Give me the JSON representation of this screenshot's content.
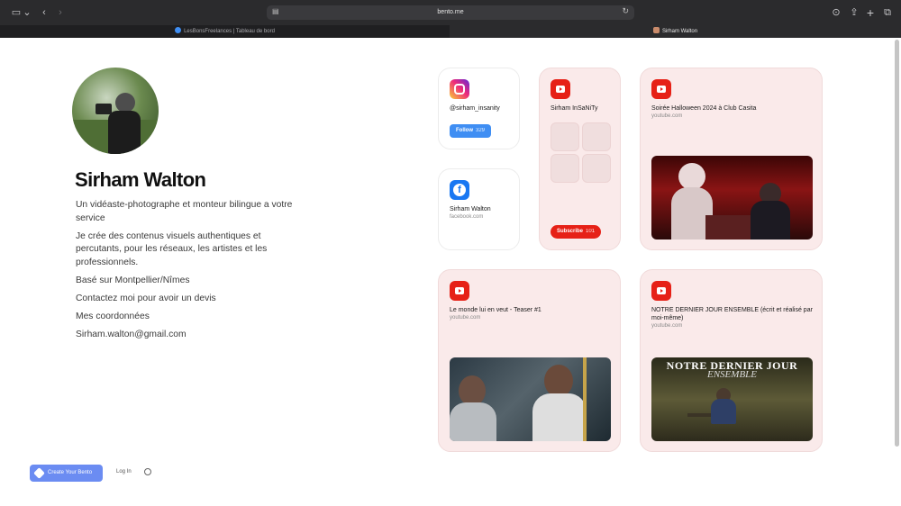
{
  "browser": {
    "url": "bento.me",
    "tabs": [
      {
        "label": "LesBonsFreelances | Tableau de bord",
        "active": false
      },
      {
        "label": "Sirham Walton",
        "active": true
      }
    ]
  },
  "profile": {
    "name": "Sirham Walton",
    "bio": [
      "Un vidéaste-photographe et monteur bilingue a votre service",
      "Je crée des contenus visuels authentiques et percutants, pour les réseaux, les artistes et les professionnels.",
      "Basé sur Montpellier/Nîmes",
      "Contactez moi pour avoir un devis",
      "Mes coordonnées",
      "Sirham.walton@gmail.com"
    ]
  },
  "footer": {
    "create_label": "Create Your Bento",
    "login_label": "Log In"
  },
  "cards": {
    "instagram": {
      "handle": "@sirham_insanity",
      "button": "Follow",
      "count": "329",
      "icon": "instagram-icon"
    },
    "facebook": {
      "title": "Sirham Walton",
      "domain": "facebook.com",
      "icon": "facebook-icon"
    },
    "youtube_channel": {
      "title": "Sirham InSaNiTy",
      "button": "Subscribe",
      "count": "101",
      "icon": "youtube-icon"
    },
    "halloween": {
      "title": "Soirée Halloween 2024 à Club Casita",
      "domain": "youtube.com",
      "icon": "youtube-icon"
    },
    "teaser": {
      "title": "Le monde lui en veut - Teaser #1",
      "domain": "youtube.com",
      "icon": "youtube-icon"
    },
    "dernier": {
      "title": "NOTRE DERNIER JOUR ENSEMBLE (écrit et réalisé par moi-même)",
      "domain": "youtube.com",
      "icon": "youtube-icon",
      "thumb_line1": "NOTRE DERNIER JOUR",
      "thumb_line2": "ENSEMBLE"
    }
  },
  "colors": {
    "accent": "#6b8cf2",
    "youtube": "#e62117",
    "facebook": "#1877f2",
    "card_pink": "#faeaea"
  }
}
